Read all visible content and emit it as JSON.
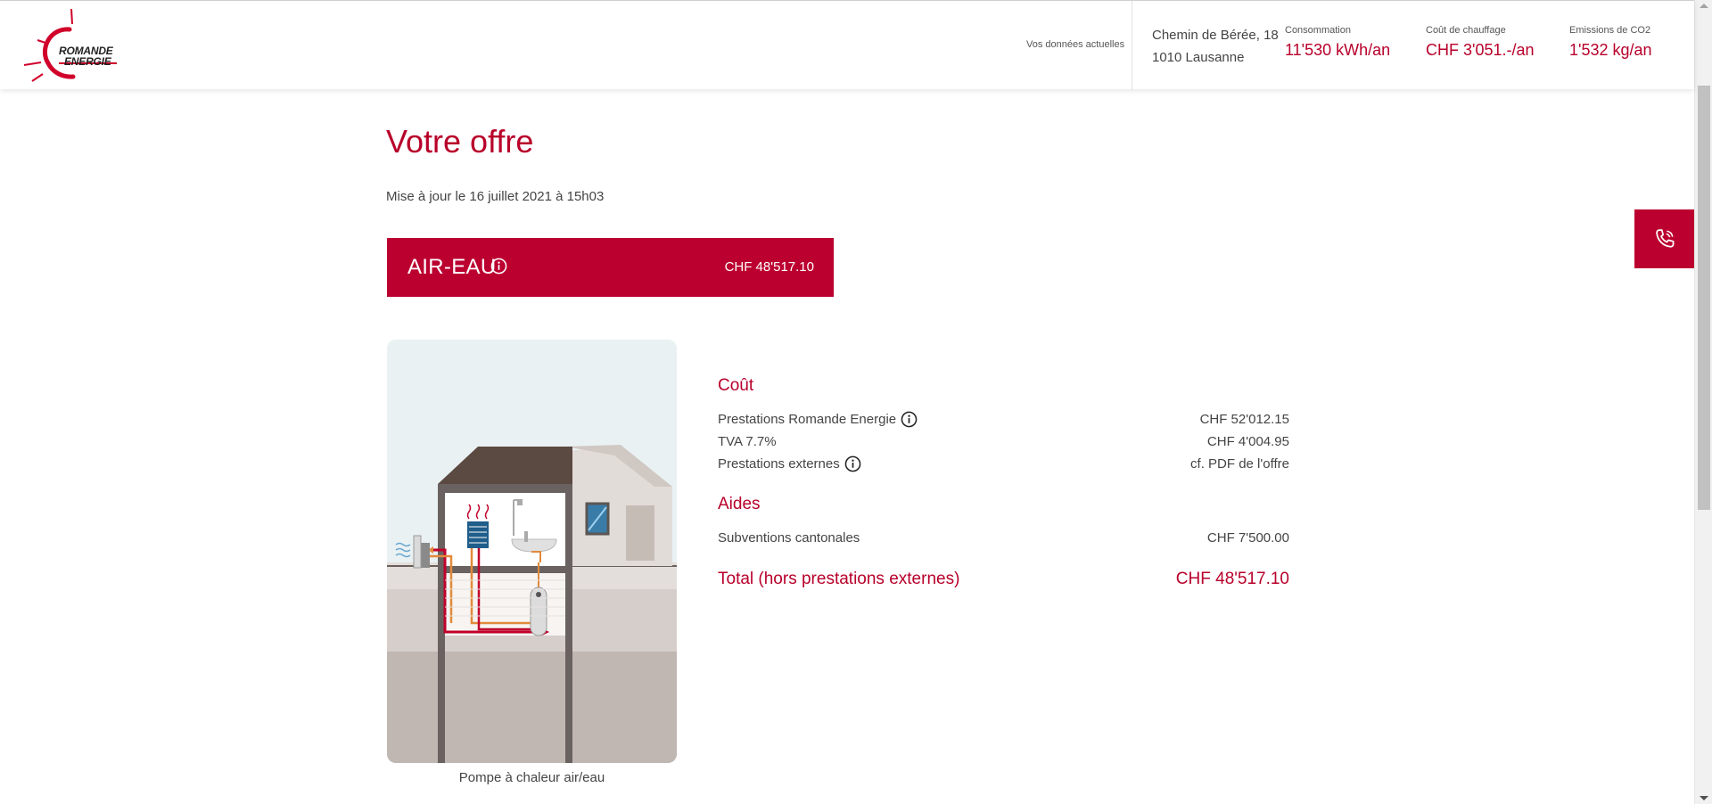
{
  "header": {
    "logo_text_line1": "ROMANDE",
    "logo_text_line2": "ENERGIE",
    "current_data_label": "Vos données actuelles",
    "address_line1": "Chemin de Bérée, 18",
    "address_line2": "1010 Lausanne",
    "metrics": [
      {
        "label": "Consommation",
        "value": "11'530 kWh/an"
      },
      {
        "label": "Coût de chauffage",
        "value": "CHF 3'051.-/an"
      },
      {
        "label": "Emissions de CO2",
        "value": "1'532 kg/an"
      }
    ]
  },
  "main": {
    "title": "Votre offre",
    "updated": "Mise à jour le 16 juillet 2021 à 15h03",
    "offer": {
      "name": "AIR-EAU",
      "price": "CHF 48'517.10"
    },
    "illustration_caption": "Pompe à chaleur air/eau",
    "cost": {
      "title": "Coût",
      "rows": [
        {
          "label": "Prestations Romande Energie",
          "value": "CHF 52'012.15",
          "info": true
        },
        {
          "label": "TVA 7.7%",
          "value": "CHF 4'004.95",
          "info": false
        },
        {
          "label": "Prestations externes",
          "value": "cf. PDF de l'offre",
          "info": true
        }
      ]
    },
    "aids": {
      "title": "Aides",
      "rows": [
        {
          "label": "Subventions cantonales",
          "value": "CHF 7'500.00"
        }
      ]
    },
    "total": {
      "label": "Total (hors prestations externes)",
      "value": "CHF 48'517.10"
    }
  },
  "colors": {
    "brand_red": "#bb0030",
    "text": "#444444"
  },
  "icons": [
    "logo-sun-icon",
    "info-icon",
    "phone-icon"
  ]
}
